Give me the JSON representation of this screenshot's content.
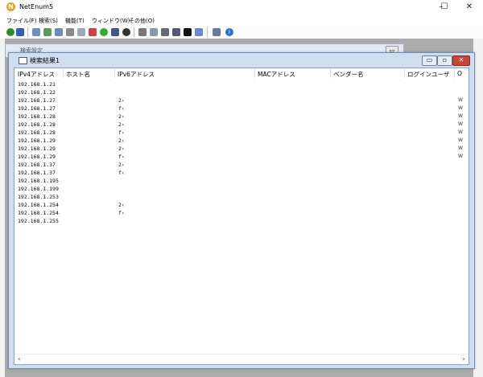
{
  "app": {
    "title": "NetEnum5"
  },
  "window_controls": {
    "minimize": "–",
    "maximize": "☐",
    "close": "✕"
  },
  "menu": [
    "ファイル(F)",
    "検索(S)",
    "機能(T)",
    "ウィンドウ(W)",
    "その他(O)"
  ],
  "background_window": {
    "title": "検索設定"
  },
  "results_window": {
    "title": "検索結果1",
    "columns": [
      "IPv4アドレス",
      "ホスト名",
      "IPv6アドレス",
      "MACアドレス",
      "ベンダー名",
      "ログインユーザ",
      "O"
    ],
    "rows": [
      {
        "ipv4": "192.168.1.21",
        "ipv6": "",
        "mark": ""
      },
      {
        "ipv4": "192.168.1.22",
        "ipv6": "",
        "mark": ""
      },
      {
        "ipv4": "192.168.1.27",
        "ipv6": "2‹",
        "mark": "W"
      },
      {
        "ipv4": "192.168.1.27",
        "ipv6": "f‹",
        "mark": "W"
      },
      {
        "ipv4": "192.168.1.28",
        "ipv6": "2‹",
        "mark": "W"
      },
      {
        "ipv4": "192.168.1.28",
        "ipv6": "2‹",
        "mark": "W"
      },
      {
        "ipv4": "192.168.1.28",
        "ipv6": "f‹",
        "mark": "W"
      },
      {
        "ipv4": "192.168.1.29",
        "ipv6": "2‹",
        "mark": "W"
      },
      {
        "ipv4": "192.168.1.29",
        "ipv6": "2‹",
        "mark": "W"
      },
      {
        "ipv4": "192.168.1.29",
        "ipv6": "f‹",
        "mark": "W"
      },
      {
        "ipv4": "192.168.1.37",
        "ipv6": "2‹",
        "mark": ""
      },
      {
        "ipv4": "192.168.1.37",
        "ipv6": "f‹",
        "mark": ""
      },
      {
        "ipv4": "192.168.1.195",
        "ipv6": "",
        "mark": ""
      },
      {
        "ipv4": "192.168.1.199",
        "ipv6": "",
        "mark": ""
      },
      {
        "ipv4": "192.168.1.253",
        "ipv6": "",
        "mark": ""
      },
      {
        "ipv4": "192.168.1.254",
        "ipv6": "2‹",
        "mark": ""
      },
      {
        "ipv4": "192.168.1.254",
        "ipv6": "f‹",
        "mark": ""
      },
      {
        "ipv4": "192.168.1.255",
        "ipv6": "",
        "mark": ""
      }
    ]
  },
  "scrollbar": {
    "left_arrow": "‹",
    "right_arrow": "›"
  },
  "colors": {
    "mdi_background": "#ababab",
    "window_frame": "#cfdff0",
    "close_button": "#c8453a"
  }
}
